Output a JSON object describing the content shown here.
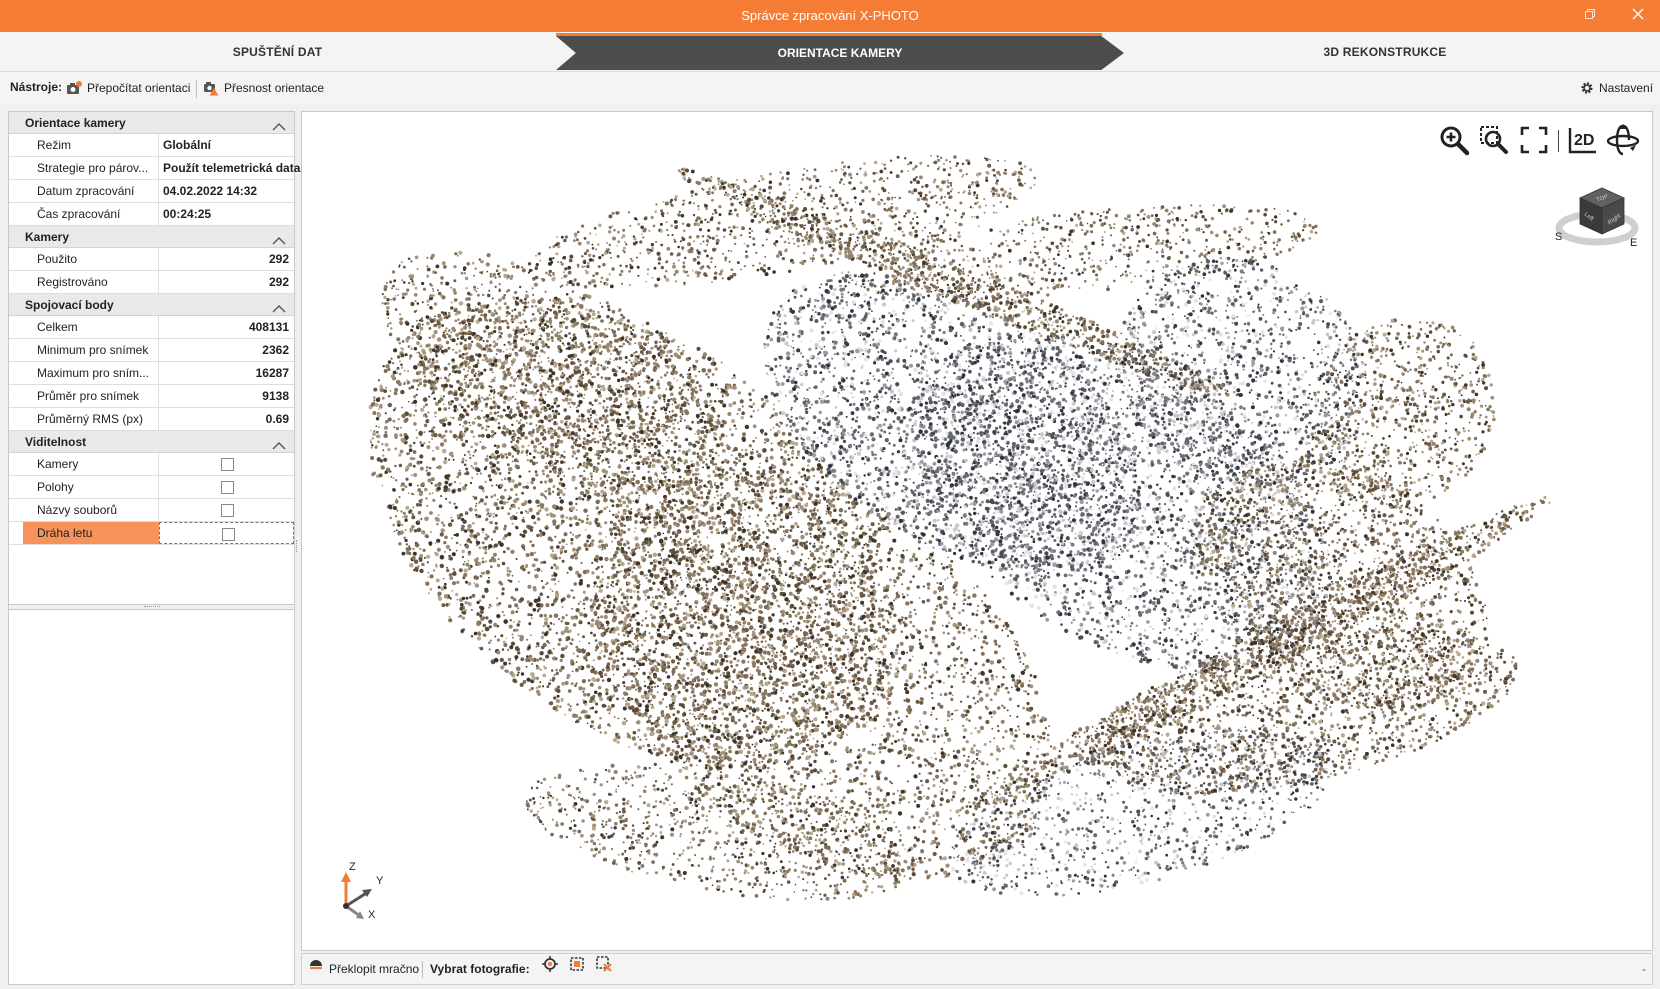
{
  "window": {
    "title": "Správce zpracování X-PHOTO",
    "restore_icon": "restore-icon",
    "close_icon": "close-icon",
    "accent_color": "#f47c34"
  },
  "steps": [
    {
      "label": "SPUŠTĚNÍ DAT",
      "active": false
    },
    {
      "label": "ORIENTACE KAMERY",
      "active": true
    },
    {
      "label": "3D REKONSTRUKCE",
      "active": false
    }
  ],
  "toolbar": {
    "label": "Nástroje:",
    "recalc": "Přepočítat orientaci",
    "accuracy": "Přesnost orientace",
    "settings": "Nastavení"
  },
  "panel": {
    "sections": [
      {
        "title": "Orientace kamery",
        "rows": [
          {
            "key": "Režim",
            "value": "Globální"
          },
          {
            "key": "Strategie pro párov...",
            "value": "Použít telemetrická data"
          },
          {
            "key": "Datum zpracování",
            "value": "04.02.2022 14:32"
          },
          {
            "key": "Čas zpracování",
            "value": "00:24:25"
          }
        ]
      },
      {
        "title": "Kamery",
        "rows": [
          {
            "key": "Použito",
            "value": "292"
          },
          {
            "key": "Registrováno",
            "value": "292"
          }
        ]
      },
      {
        "title": "Spojovací body",
        "rows": [
          {
            "key": "Celkem",
            "value": "408131"
          },
          {
            "key": "Minimum pro snímek",
            "value": "2362"
          },
          {
            "key": "Maximum pro sním...",
            "value": "16287"
          },
          {
            "key": "Průměr pro snímek",
            "value": "9138"
          },
          {
            "key": "Průměrný RMS (px)",
            "value": "0.69"
          }
        ]
      },
      {
        "title": "Viditelnost",
        "rows": [
          {
            "key": "Kamery",
            "checked": false
          },
          {
            "key": "Polohy",
            "checked": false
          },
          {
            "key": "Názvy souborů",
            "checked": false
          },
          {
            "key": "Dráha letu",
            "checked": false,
            "selected": true
          }
        ]
      }
    ]
  },
  "viewer": {
    "tools": [
      "zoom-in-icon",
      "zoom-area-icon",
      "fit-view-icon",
      "mode-2d-icon",
      "orbit-icon"
    ],
    "mode_label": "2D",
    "cube": {
      "top": "TOP",
      "left": "Left",
      "right": "Right",
      "compass_s": "S",
      "compass_e": "E"
    },
    "axes": {
      "z": "Z",
      "y": "Y",
      "x": "X"
    }
  },
  "bottombar": {
    "flip": "Překlopit mračno",
    "select_label": "Vybrat fotografie:",
    "dash": "-"
  }
}
